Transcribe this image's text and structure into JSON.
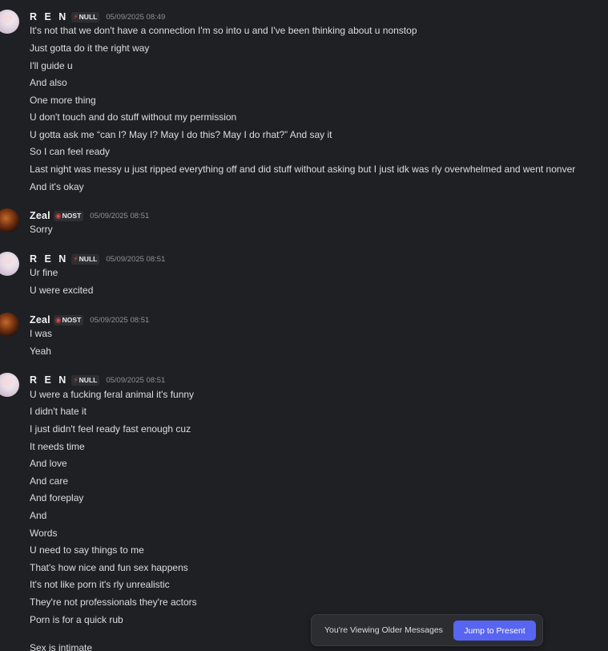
{
  "messages": [
    {
      "author": "R E N",
      "avatar_icon": "ren-avatar",
      "tag": "NULL",
      "tag_icon": "lightning-bolt-icon",
      "timestamp": "05/09/2025 08:49",
      "lines": [
        "It's not that we don't have a connection I'm so into u and I've been thinking about u nonstop",
        "Just gotta do it the right way",
        "I'll guide u",
        "And also",
        "One more thing",
        "U don't touch and do stuff without my permission",
        "U gotta ask me “can I? May I? May I do this? May I do rhat?” And say it",
        "So I can feel ready",
        "Last night was messy u just ripped everything off and did stuff without asking but I just idk was rly overwhelmed and went nonver",
        "And it's okay"
      ]
    },
    {
      "author": "Zeal",
      "avatar_icon": "zeal-avatar",
      "tag": "NOST",
      "tag_icon": "red-ring-icon",
      "timestamp": "05/09/2025 08:51",
      "lines": [
        "Sorry"
      ]
    },
    {
      "author": "R E N",
      "avatar_icon": "ren-avatar",
      "tag": "NULL",
      "tag_icon": "lightning-bolt-icon",
      "timestamp": "05/09/2025 08:51",
      "lines": [
        "Ur fine",
        "U were excited"
      ]
    },
    {
      "author": "Zeal",
      "avatar_icon": "zeal-avatar",
      "tag": "NOST",
      "tag_icon": "red-ring-icon",
      "timestamp": "05/09/2025 08:51",
      "lines": [
        "I was",
        "Yeah"
      ]
    },
    {
      "author": "R E N",
      "avatar_icon": "ren-avatar",
      "tag": "NULL",
      "tag_icon": "lightning-bolt-icon",
      "timestamp": "05/09/2025 08:51",
      "lines": [
        "U were a fucking feral animal it's funny",
        "I didn't hate it",
        "I just didn't feel ready fast enough cuz",
        "It needs time",
        "And love",
        "And care",
        "And foreplay",
        "And",
        "Words",
        "U need to say things to me",
        "That's how nice and fun sex happens",
        "It's not like porn it's rly unrealistic",
        "They're not professionals they're actors",
        "Porn is for a quick rub",
        "",
        "Sex is intimate"
      ]
    }
  ],
  "older_banner": {
    "text": "You're Viewing Older Messages",
    "button_label": "Jump to Present"
  },
  "colors": {
    "background": "#1f2023",
    "accent": "#5865f2",
    "timestamp": "#8e9297",
    "text": "#dbdee1"
  }
}
